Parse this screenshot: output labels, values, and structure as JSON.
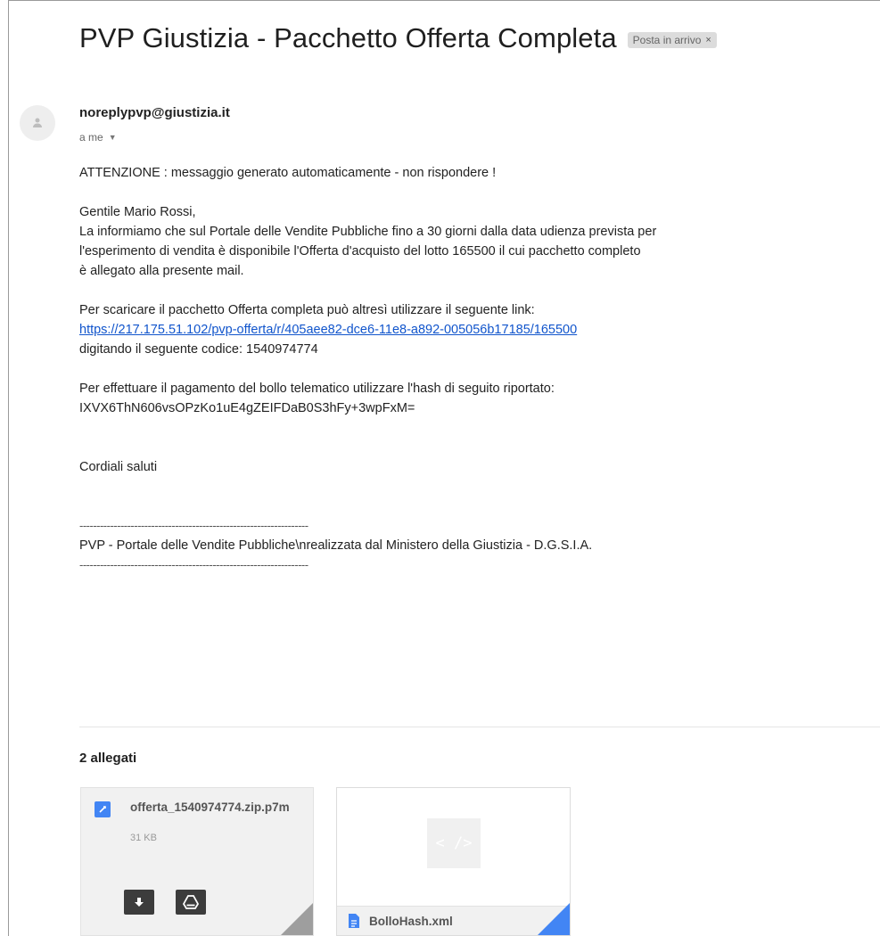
{
  "email": {
    "subject": "PVP Giustizia - Pacchetto Offerta Completa",
    "label": "Posta in arrivo",
    "label_close": "×",
    "sender": "noreplypvp@giustizia.it",
    "recipient": "a me",
    "recipient_caret": "▼",
    "body": {
      "warning": "ATTENZIONE : messaggio generato automaticamente - non rispondere !",
      "greeting": "Gentile Mario Rossi,",
      "p1_l1": "La informiamo che sul Portale delle Vendite Pubbliche fino a 30 giorni dalla data udienza prevista per",
      "p1_l2": "l'esperimento di vendita è disponibile l'Offerta d'acquisto del lotto 165500 il cui pacchetto completo",
      "p1_l3": "è allegato alla presente mail.",
      "p2_l1": "Per scaricare il pacchetto Offerta completa può altresì utilizzare il seguente link:",
      "link": "https://217.175.51.102/pvp-offerta/r/405aee82-dce6-11e8-a892-005056b17185/165500",
      "p2_l3": "digitando il seguente codice: 1540974774",
      "p3_l1": "Per effettuare il pagamento del bollo telematico utilizzare l'hash di seguito riportato:",
      "hash": "IXVX6ThN606vsOPzKo1uE4gZEIFDaB0S3hFy+3wpFxM=",
      "closing": "Cordiali saluti",
      "dashes": "-------------------------------------------------------------------",
      "signature": "PVP - Portale delle Vendite Pubbliche\\nrealizzata dal Ministero della Giustizia - D.G.S.I.A."
    }
  },
  "attachments": {
    "title": "2 allegati",
    "items": [
      {
        "name": "offerta_1540974774.zip.p7m",
        "size": "31 KB",
        "icon": "zip-file-icon"
      },
      {
        "name": "BolloHash.xml",
        "preview": "< />",
        "icon": "doc-file-icon"
      }
    ]
  },
  "colors": {
    "link": "#1155cc",
    "accent": "#4285f4"
  }
}
